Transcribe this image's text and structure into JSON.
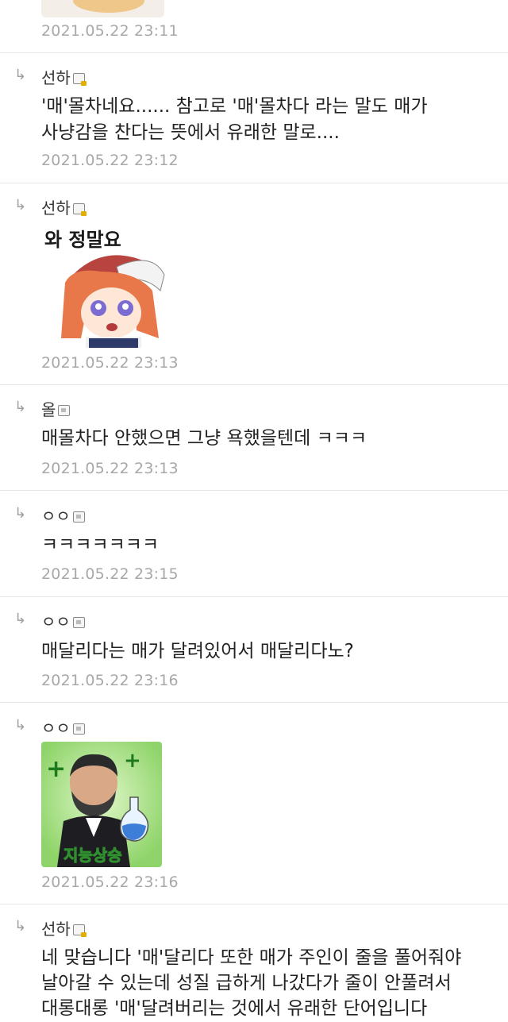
{
  "comments": [
    {
      "time": "2021.05.22 23:11"
    },
    {
      "author": "선하",
      "text_lines": [
        "'매'몰차네요...... 참고로 '매'몰차다 라는 말도 매가",
        "사냥감을 찬다는 뜻에서 유래한 말로...."
      ],
      "time": "2021.05.22 23:12"
    },
    {
      "author": "선하",
      "sticker_text": "와 정말요",
      "time": "2021.05.22 23:13"
    },
    {
      "author": "올",
      "text_lines": [
        "매몰차다 안했으면 그냥 욕했을텐데 ㅋㅋㅋ"
      ],
      "time": "2021.05.22 23:13"
    },
    {
      "author": "ㅇㅇ",
      "text_lines": [
        "ㅋㅋㅋㅋㅋㅋㅋ"
      ],
      "time": "2021.05.22 23:15"
    },
    {
      "author": "ㅇㅇ",
      "text_lines": [
        "매달리다는 매가 달려있어서 매달리다노?"
      ],
      "time": "2021.05.22 23:16"
    },
    {
      "author": "ㅇㅇ",
      "sticker_text": "지능상승",
      "time": "2021.05.22 23:16"
    },
    {
      "author": "선하",
      "text_lines": [
        "네 맞습니다 '매'달리다 또한 매가 주인이 줄을 풀어줘야",
        "날아갈 수 있는데 성질 급하게 나갔다가 줄이 안풀려서",
        "대롱대롱 '매'달려버리는 것에서 유래한 단어입니다"
      ]
    }
  ],
  "reply_symbol": "↳",
  "colors": {
    "timestamp": "#a8a8a8",
    "divider": "#e6e6e6",
    "text": "#222222"
  }
}
